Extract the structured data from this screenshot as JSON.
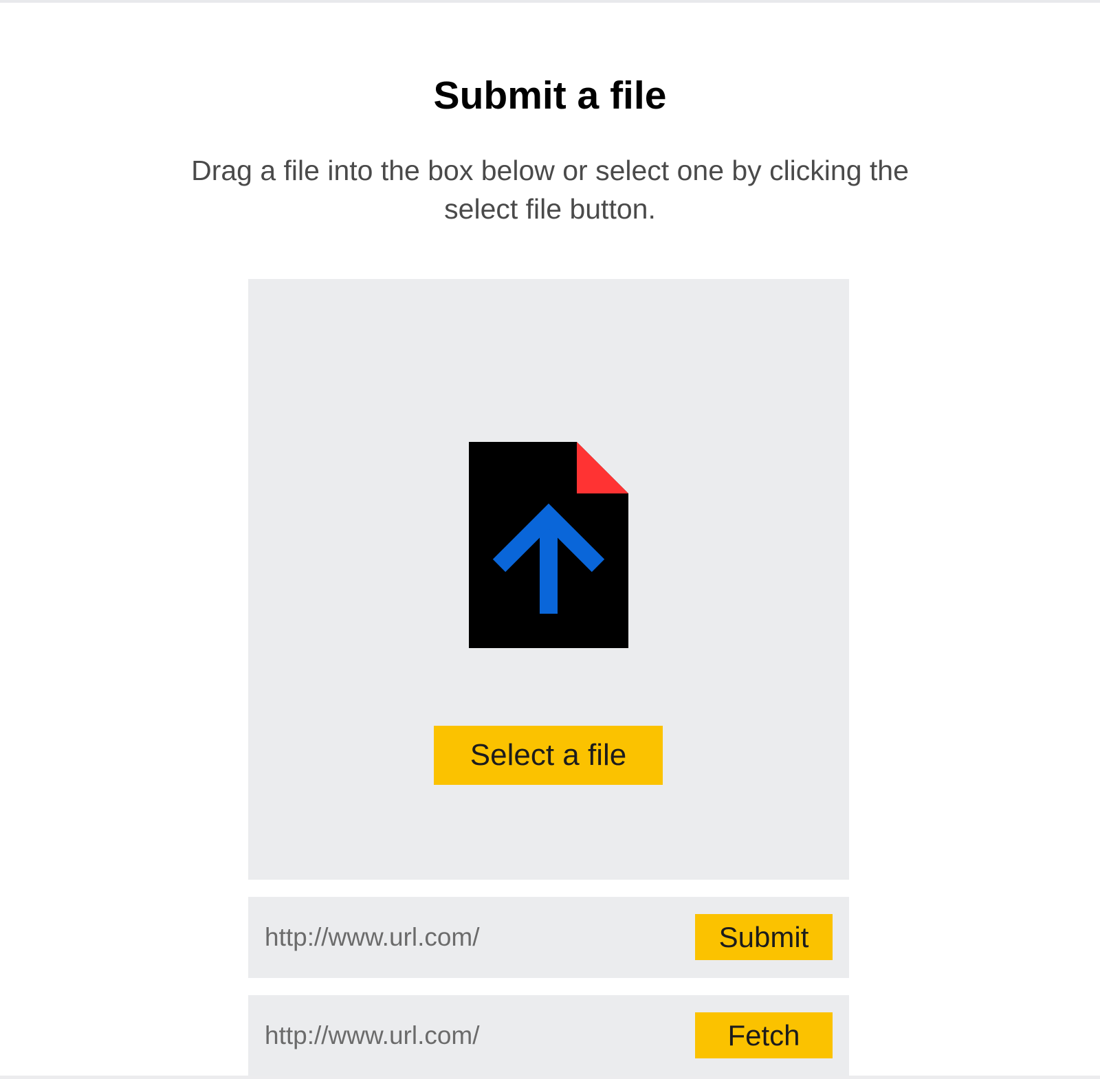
{
  "header": {
    "title": "Submit a file",
    "subtitle": "Drag a file into the box below or select one by clicking the select file button."
  },
  "drop_zone": {
    "icon": "file-upload-icon",
    "select_button_label": "Select a file"
  },
  "submit_row": {
    "placeholder": "http://www.url.com/",
    "button_label": "Submit"
  },
  "fetch_row": {
    "placeholder": "http://www.url.com/",
    "button_label": "Fetch"
  },
  "colors": {
    "accent": "#fbc200",
    "panel_background": "#ebecee",
    "icon_body": "#000000",
    "icon_corner": "#ff3333",
    "icon_arrow": "#0a66d9"
  }
}
